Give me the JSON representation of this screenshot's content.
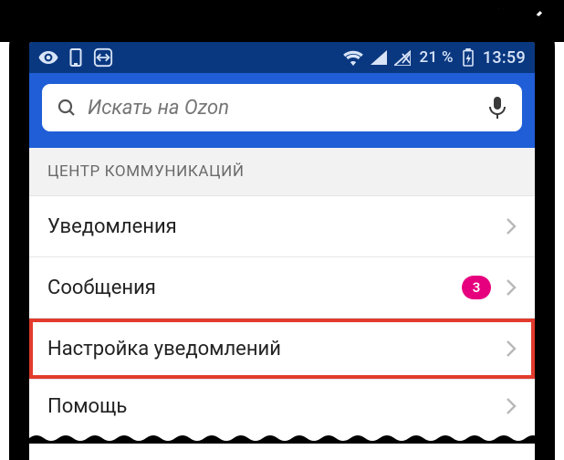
{
  "device_controls": {
    "open_external": "open-external",
    "close": "close"
  },
  "status_bar": {
    "left_icons": [
      "eye",
      "device",
      "teamviewer"
    ],
    "wifi": true,
    "signal1": true,
    "signal2_off": true,
    "battery_percent": "21 %",
    "battery_charging": true,
    "clock": "13:59"
  },
  "search": {
    "placeholder": "Искать на Ozon",
    "value": ""
  },
  "section_title": "ЦЕНТР КОММУНИКАЦИЙ",
  "items": [
    {
      "label": "Уведомления",
      "badge": null,
      "highlight": false
    },
    {
      "label": "Сообщения",
      "badge": "3",
      "highlight": false
    },
    {
      "label": "Настройка уведомлений",
      "badge": null,
      "highlight": true
    },
    {
      "label": "Помощь",
      "badge": null,
      "highlight": false
    }
  ]
}
